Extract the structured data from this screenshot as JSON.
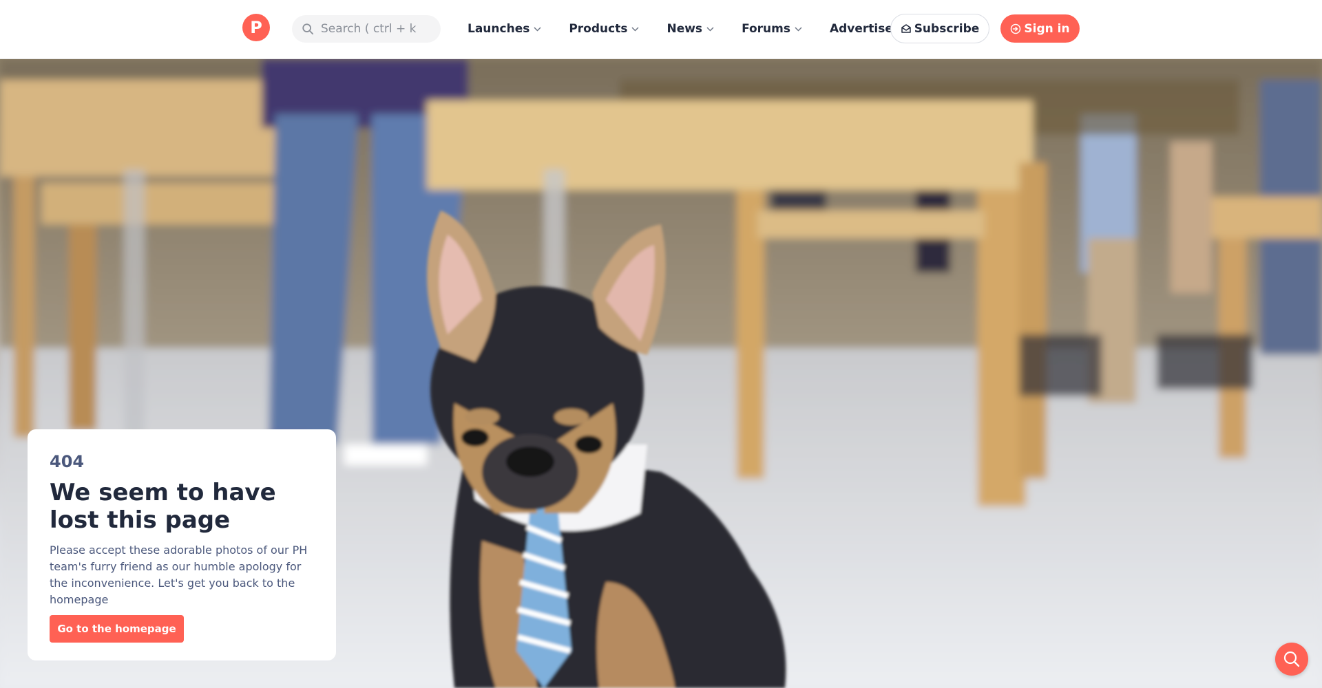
{
  "header": {
    "logo_letter": "P",
    "search": {
      "placeholder": "Search ( ctrl + k"
    },
    "nav": [
      {
        "label": "Launches",
        "has_dropdown": true
      },
      {
        "label": "Products",
        "has_dropdown": true
      },
      {
        "label": "News",
        "has_dropdown": true
      },
      {
        "label": "Forums",
        "has_dropdown": true
      },
      {
        "label": "Advertise",
        "has_dropdown": false
      }
    ],
    "subscribe_label": "Subscribe",
    "signin_label": "Sign in"
  },
  "hero": {
    "image": "french-bulldog-with-tie-photo"
  },
  "error_card": {
    "code": "404",
    "title": "We seem to have lost this page",
    "description": "Please accept these adorable photos of our PH team's furry friend as our humble apology for the inconvenience. Let's get you back to the homepage",
    "button_label": "Go to the homepage"
  },
  "fab": {
    "icon": "search-chat-icon"
  },
  "colors": {
    "brand": "#ff6154",
    "text_dark": "#21293c",
    "text_muted": "#4b587c"
  }
}
